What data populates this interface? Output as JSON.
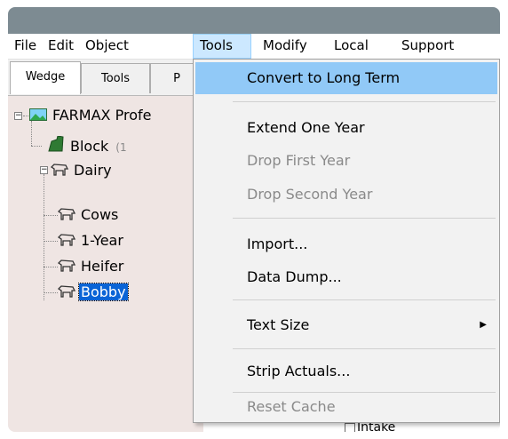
{
  "menubar": {
    "items": [
      "File",
      "Edit",
      "Object",
      "Tools",
      "Modify",
      "Local",
      "Support"
    ]
  },
  "tabs": [
    "Wedge",
    "Tools",
    "P"
  ],
  "tree": {
    "root": "FARMAX Profe",
    "block": "Block",
    "block_sub": "(1",
    "dairy": "Dairy",
    "cows": "Cows",
    "yearling": "1-Year",
    "heifer": "Heifer",
    "bobby": "Bobby"
  },
  "tools_menu": {
    "items": [
      {
        "label": "Convert to Long Term",
        "state": "highlighted"
      },
      {
        "label": "Extend One Year",
        "state": "enabled"
      },
      {
        "label": "Drop First Year",
        "state": "disabled"
      },
      {
        "label": "Drop Second Year",
        "state": "disabled"
      },
      {
        "label": "Import...",
        "state": "enabled"
      },
      {
        "label": "Data Dump...",
        "state": "enabled"
      },
      {
        "label": "Text Size",
        "state": "enabled",
        "submenu": true
      },
      {
        "label": "Strip Actuals...",
        "state": "enabled"
      },
      {
        "label": "Reset Cache",
        "state": "disabled"
      }
    ]
  },
  "background_text": {
    "intake": "Intake"
  },
  "colors": {
    "highlight": "#91c9f7",
    "selection": "#0a64d6",
    "tree_background": "#efe5e3"
  }
}
